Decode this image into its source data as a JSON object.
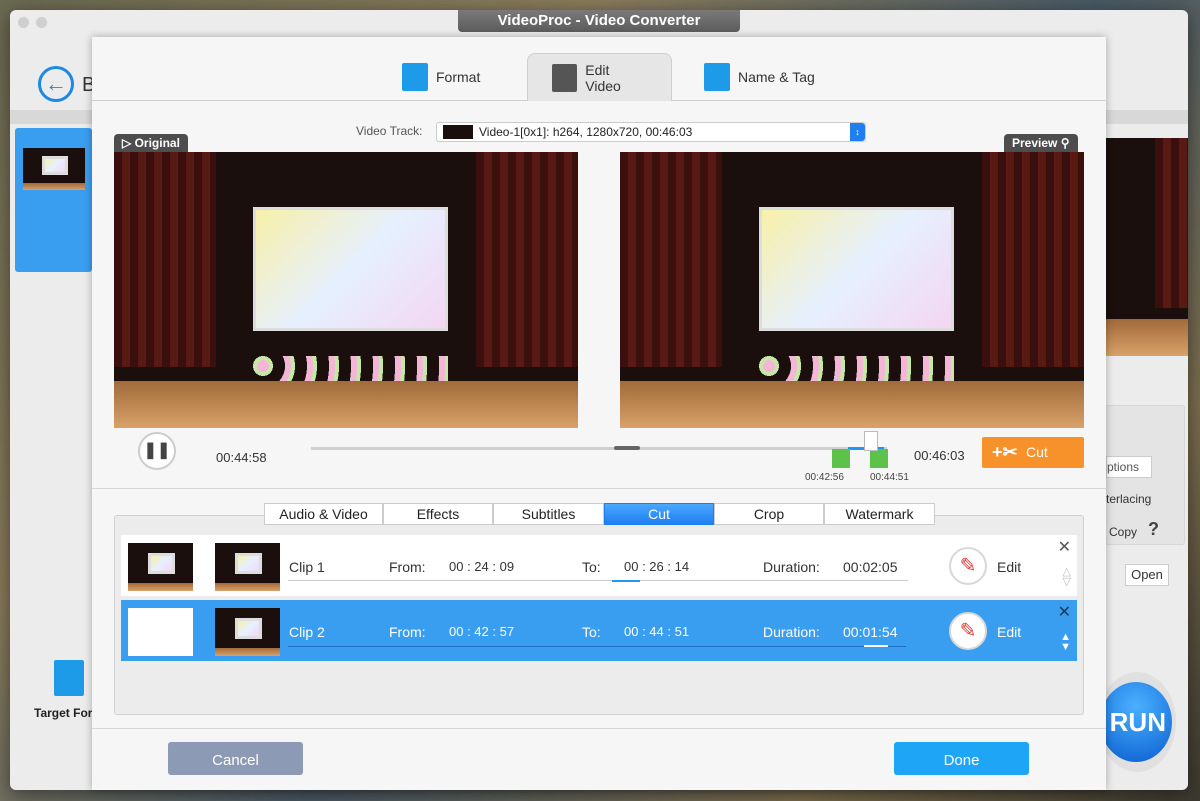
{
  "window": {
    "title": "VideoProc - Video Converter",
    "back_label": "B",
    "target_label": "Target For",
    "right_options": "ptions",
    "right_deinterlacing": "terlacing",
    "right_copy": "Copy",
    "right_help": "?",
    "right_open": "Open",
    "run_label": "RUN"
  },
  "top_tabs": [
    {
      "label": "Format",
      "icon": "format-icon"
    },
    {
      "label": "Edit Video",
      "icon": "edit-video-icon",
      "selected": true
    },
    {
      "label": "Name & Tag",
      "icon": "name-tag-icon"
    }
  ],
  "video_track": {
    "label": "Video Track:",
    "value": "Video-1[0x1]: h264, 1280x720, 00:46:03"
  },
  "original_label": "Original",
  "preview_label": "Preview",
  "player": {
    "current_time": "00:44:58",
    "total_time": "00:46:03",
    "marker_start": "00:42:56",
    "marker_end": "00:44:51",
    "cut_label": "Cut"
  },
  "sub_tabs": [
    {
      "label": "Audio & Video"
    },
    {
      "label": "Effects"
    },
    {
      "label": "Subtitles"
    },
    {
      "label": "Cut",
      "selected": true
    },
    {
      "label": "Crop"
    },
    {
      "label": "Watermark"
    }
  ],
  "clips": [
    {
      "name": "Clip 1",
      "from_label": "From:",
      "from": "00 : 24 : 09",
      "to_label": "To:",
      "to": "00 : 26 : 14",
      "duration_label": "Duration:",
      "duration": "00:02:05",
      "edit": "Edit",
      "selected": false
    },
    {
      "name": "Clip 2",
      "from_label": "From:",
      "from": "00 : 42 : 57",
      "to_label": "To:",
      "to": "00 : 44 : 51",
      "duration_label": "Duration:",
      "duration": "00:01:54",
      "edit": "Edit",
      "selected": true
    }
  ],
  "footer": {
    "cancel": "Cancel",
    "done": "Done"
  },
  "colors": {
    "accent": "#1f8ff0",
    "cut_button": "#f7922a",
    "done": "#1ea5f5",
    "cancel": "#8d9ab5",
    "marker": "#5cc24a"
  }
}
